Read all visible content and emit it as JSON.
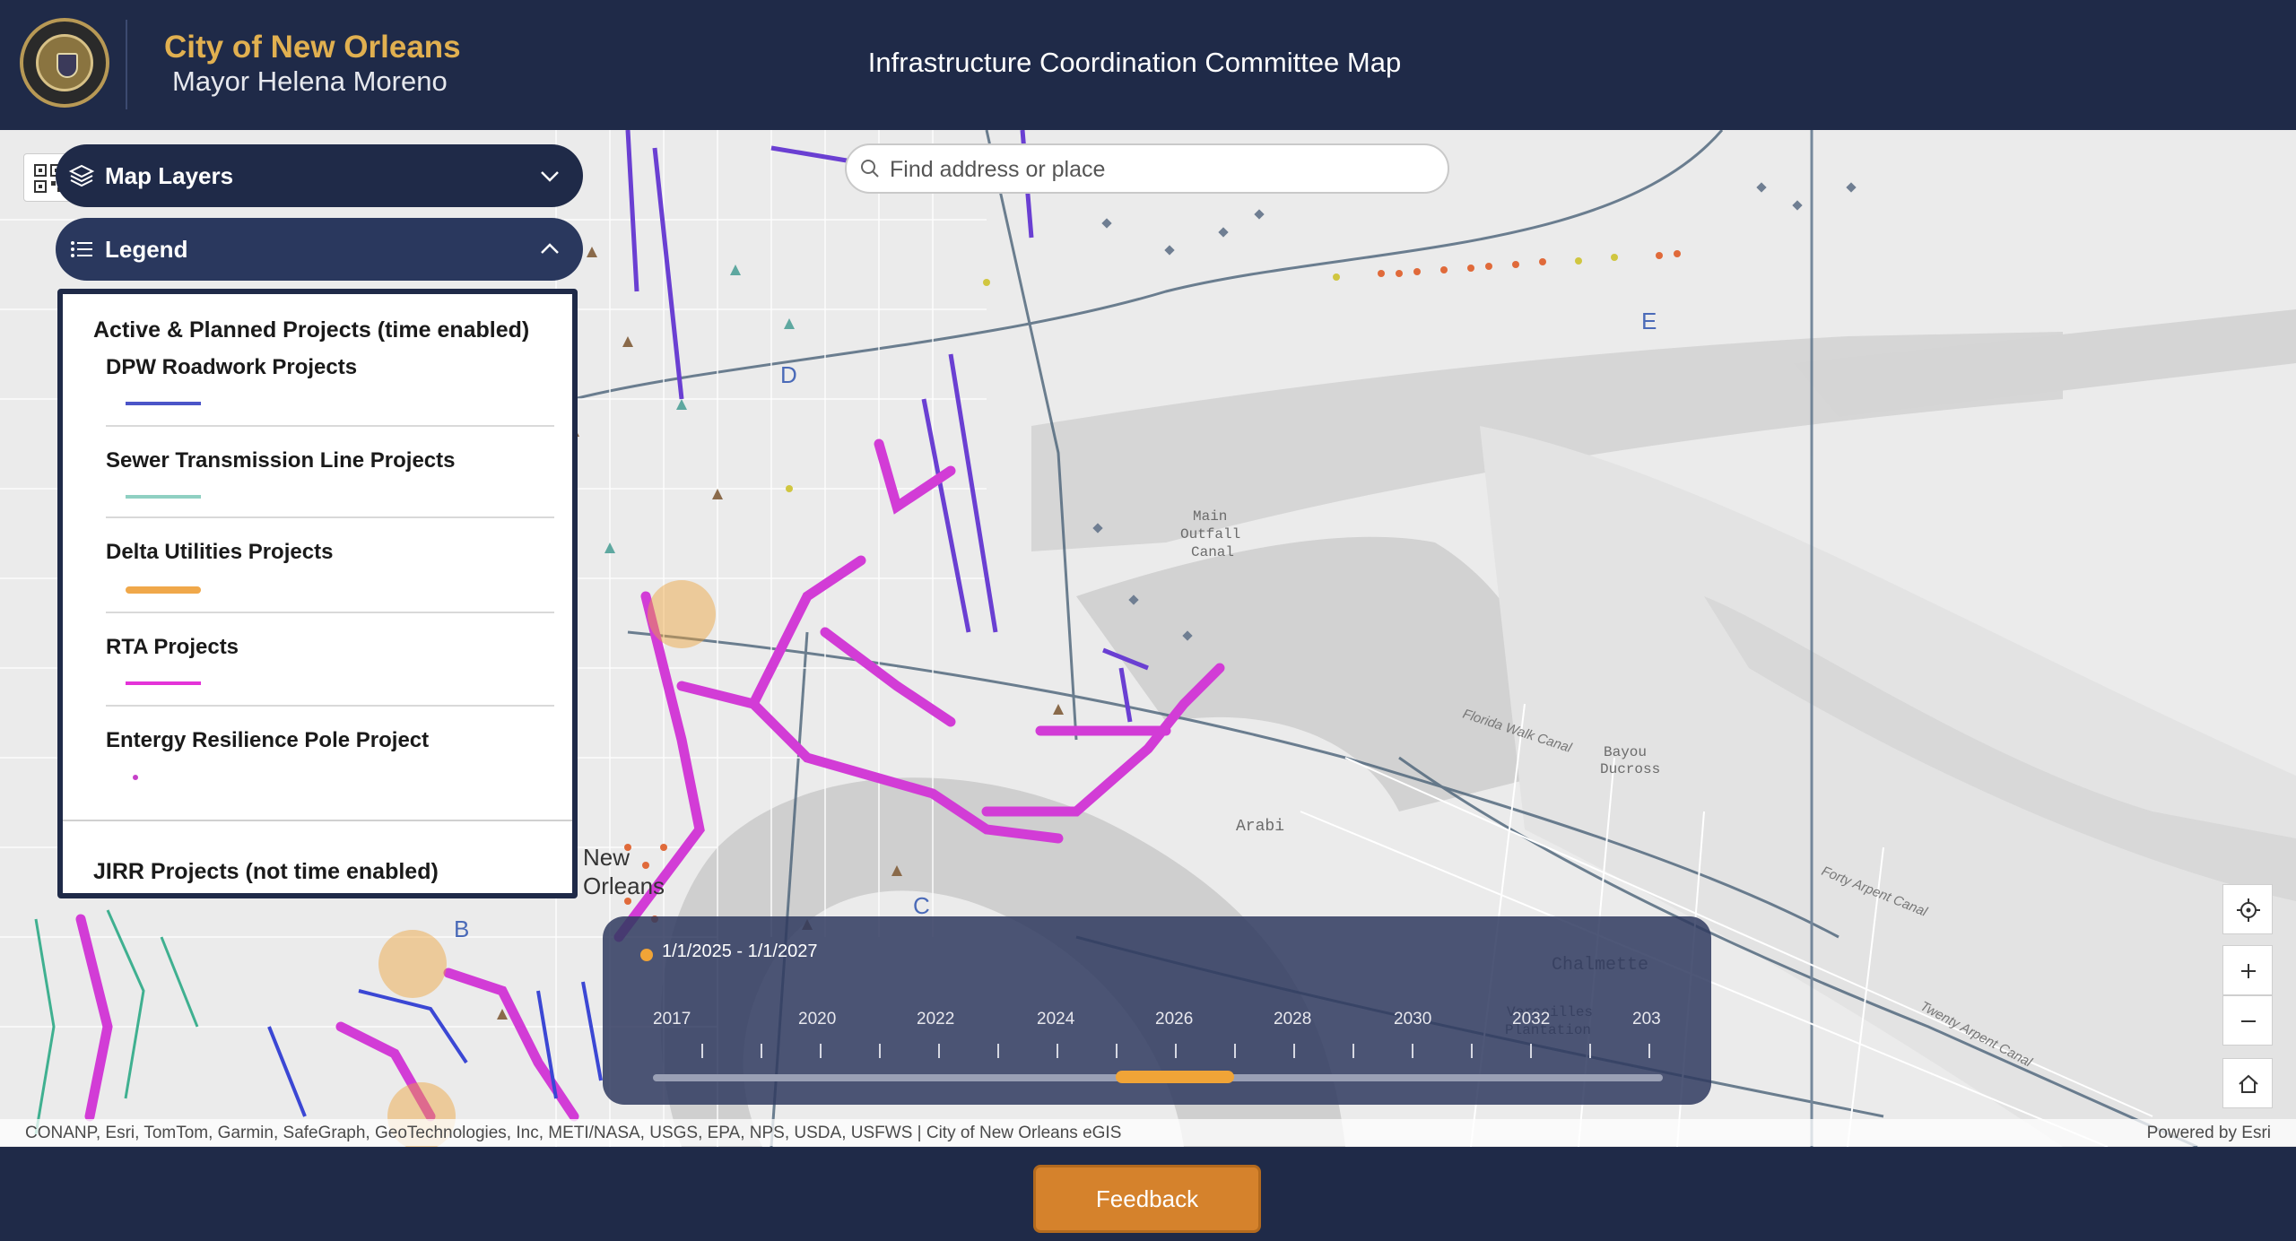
{
  "header": {
    "brand_title": "City of New Orleans",
    "brand_subtitle": "Mayor Helena Moreno",
    "app_title": "Infrastructure Coordination Committee Map",
    "seal_icon": "city-seal"
  },
  "search": {
    "placeholder": "Find address or place"
  },
  "panels": {
    "map_layers_label": "Map Layers",
    "legend_label": "Legend"
  },
  "legend": {
    "section_active": "Active & Planned Projects (time enabled)",
    "items": [
      {
        "name": "DPW Roadwork Projects",
        "color": "#4b55c8"
      },
      {
        "name": "Sewer Transmission Line Projects",
        "color": "#8fd0c2"
      },
      {
        "name": "Delta Utilities Projects",
        "color": "#f0a84a"
      },
      {
        "name": "RTA Projects",
        "color": "#e433d8"
      },
      {
        "name": "Entergy Resilience Pole Project",
        "color": "#c640c8"
      }
    ],
    "section_jirr": "JIRR Projects (not time enabled)"
  },
  "map_labels": {
    "main_outfall": "Main\nOutfall\nCanal",
    "arabi": "Arabi",
    "chalmette": "Chalmette",
    "bayou_ducross": "Bayou\nDucross",
    "district_e": "E",
    "district_d": "D",
    "district_c": "C",
    "district_b": "B",
    "new_orleans": "New\nOrleans",
    "florida_walk_canal": "Florida Walk Canal",
    "forty_arpent_canal": "Forty Arpent Canal",
    "twenty_arpent_canal": "Twenty Arpent Canal",
    "versailles": "Versailles\nPlantation"
  },
  "time_slider": {
    "range_label": "1/1/2025 - 1/1/2027",
    "years": [
      "2017",
      "2020",
      "2022",
      "2024",
      "2026",
      "2028",
      "2030",
      "2032",
      "203"
    ],
    "accent_color": "#f0a437"
  },
  "attribution": {
    "left": "CONANP, Esri, TomTom, Garmin, SafeGraph, GeoTechnologies, Inc, METI/NASA, USGS, EPA, NPS, USDA, USFWS | City of New Orleans eGIS",
    "right": "Powered by Esri"
  },
  "footer": {
    "feedback_label": "Feedback"
  },
  "colors": {
    "header_bg": "#1f2a48",
    "brand_gold": "#e1b050",
    "feedback_orange": "#d5822c"
  }
}
